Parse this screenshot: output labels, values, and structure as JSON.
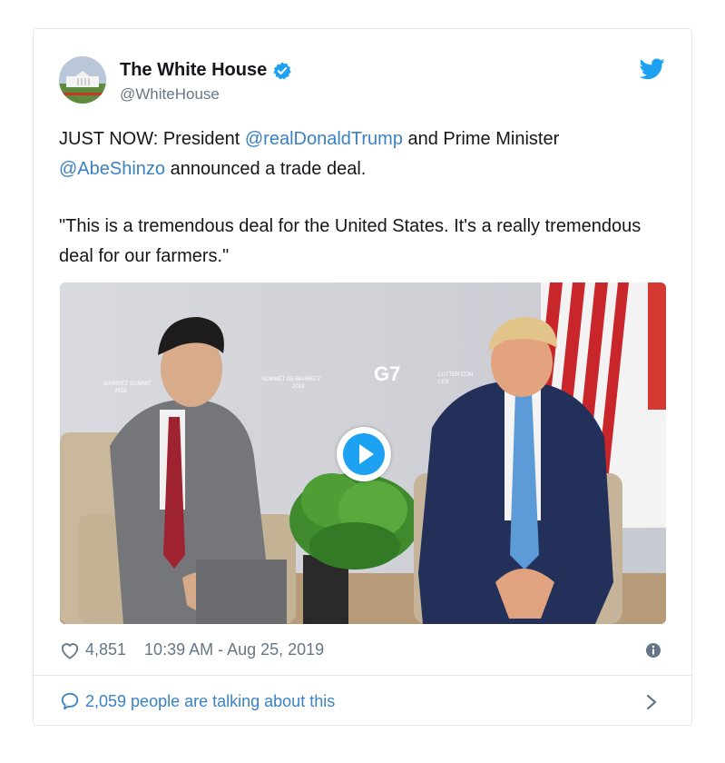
{
  "account": {
    "name": "The White House",
    "handle": "@WhiteHouse"
  },
  "tweet": {
    "line1_prefix": "JUST NOW: President ",
    "mention1": "@realDonaldTrump",
    "line1_suffix": " and Prime Minister",
    "mention2": "@AbeShinzo",
    "line2_suffix": " announced a trade deal.",
    "quote": "\"This is a tremendous deal for the United States. It's a really tremendous deal for our farmers.\""
  },
  "media": {
    "backdrop_texts": [
      "BIARRITZ SUMMIT 2019",
      "SOMMET DE BIARRITZ 2019",
      "G7",
      "LUTTER CONTRE LES..."
    ]
  },
  "meta": {
    "likes": "4,851",
    "timestamp": "10:39 AM - Aug 25, 2019"
  },
  "footer": {
    "talking": "2,059 people are talking about this"
  },
  "colors": {
    "link": "#3a82c4",
    "muted": "#657786",
    "border": "#e1e8ed",
    "twitter_blue": "#1da1f2"
  },
  "icons": [
    "avatar",
    "verified-badge-icon",
    "twitter-bird-icon",
    "play-icon",
    "heart-icon",
    "info-icon",
    "speech-bubble-icon",
    "chevron-right-icon"
  ]
}
